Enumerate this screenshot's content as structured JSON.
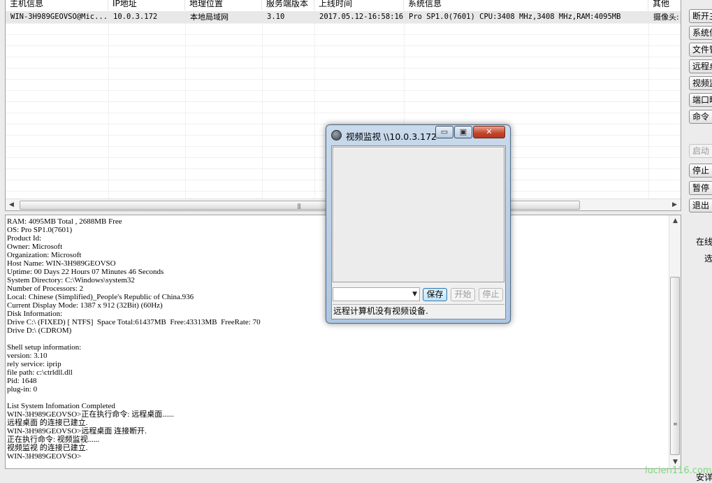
{
  "list": {
    "columns": [
      "主机信息",
      "IP地址",
      "地理位置",
      "服务端版本",
      "上线时间",
      "系统信息",
      "其他"
    ],
    "rows": [
      {
        "host": "WIN-3H989GEOVSO@Mic...",
        "ip": "10.0.3.172",
        "location": "本地局域网",
        "version": "3.10",
        "online_time": "2017.05.12-16:58:16",
        "system": "Pro SP1.0(7601) CPU:3408 MHz,3408 MHz,RAM:4095MB",
        "other": "摄像头:"
      }
    ]
  },
  "side_panel": {
    "buttons": [
      "断开主",
      "系统信",
      "文件管",
      "远程桌",
      "视频监",
      "端口映",
      "命令"
    ],
    "buttons_lower": [
      "启动",
      "停止",
      "暂停",
      "退出"
    ],
    "labels": [
      "在线",
      "选"
    ],
    "bottom_label": "安详"
  },
  "log": {
    "text": "RAM: 4095MB Total , 2688MB Free\nOS: Pro SP1.0(7601)\nProduct Id:\nOwner: Microsoft\nOrganization: Microsoft\nHost Name: WIN-3H989GEOVSO\nUptime: 00 Days 22 Hours 07 Minutes 46 Seconds\nSystem Directory: C:\\Windows\\system32\nNumber of Processors: 2\nLocal: Chinese (Simplified)_People's Republic of China.936\nCurrent Display Mode: 1387 x 912 (32Bit) (60Hz)\nDisk Information:\nDrive C:\\ (FIXED) [ NTFS]  Space Total:61437MB  Free:43313MB  FreeRate: 70\nDrive D:\\ (CDROM)\n\nShell setup information:\nversion: 3.10\nrely service: iprip\nfile path: c:\\ctrldll.dll\nPid: 1648\nplug-in: 0\n\nList System Infomation Completed\nWIN-3H989GEOVSO>正在执行命令: 远程桌面......\n远程桌面 的连接已建立.\nWIN-3H989GEOVSO>远程桌面 连接断开.\n正在执行命令: 视频监视......\n视频监视 的连接已建立.\nWIN-3H989GEOVSO>"
  },
  "dialog": {
    "title": "视频监视 \\\\10.0.3.172",
    "save_label": "保存",
    "start_label": "开始",
    "stop_label": "停止",
    "status": "远程计算机没有视频设备.",
    "minimize_glyph": "▭",
    "restore_glyph": "▣",
    "close_glyph": "✕"
  },
  "watermark": "lucien116.com",
  "colors": {
    "dialog_frame": "#aec6e0",
    "close_button": "#c4442a",
    "watermark": "#7fd77f"
  }
}
